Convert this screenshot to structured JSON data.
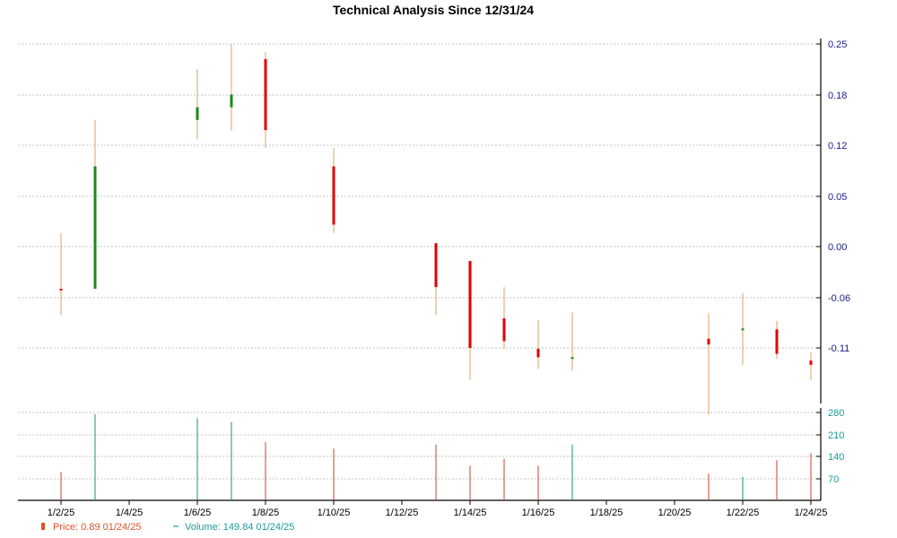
{
  "chart_data": {
    "type": "candlestick",
    "title": "Technical Analysis Since 12/31/24",
    "price_axis": {
      "ticks": [
        "0.25",
        "0.18",
        "0.12",
        "0.05",
        "0.00",
        "-0.06",
        "-0.11"
      ],
      "ylim": [
        -0.25,
        0.25
      ]
    },
    "volume_axis": {
      "ticks": [
        "280",
        "210",
        "140",
        "70"
      ],
      "ylim": [
        0,
        280
      ]
    },
    "x_ticks": [
      "1/2/25",
      "1/4/25",
      "1/6/25",
      "1/8/25",
      "1/10/25",
      "1/12/25",
      "1/14/25",
      "1/16/25",
      "1/18/25",
      "1/20/25",
      "1/22/25",
      "1/24/25"
    ],
    "candles": [
      {
        "date": "1/2/25",
        "open": -0.04,
        "high": 0.026,
        "low": -0.071,
        "close": -0.042,
        "volume": 90
      },
      {
        "date": "1/3/25",
        "open": -0.04,
        "high": 0.16,
        "low": -0.04,
        "close": 0.105,
        "volume": 275
      },
      {
        "date": "1/6/25",
        "open": 0.16,
        "high": 0.22,
        "low": 0.137,
        "close": 0.175,
        "volume": 262
      },
      {
        "date": "1/7/25",
        "open": 0.175,
        "high": 0.25,
        "low": 0.147,
        "close": 0.19,
        "volume": 250
      },
      {
        "date": "1/8/25",
        "open": 0.232,
        "high": 0.24,
        "low": 0.127,
        "close": 0.148,
        "volume": 185
      },
      {
        "date": "1/10/25",
        "open": 0.105,
        "high": 0.127,
        "low": 0.026,
        "close": 0.036,
        "volume": 165
      },
      {
        "date": "1/13/25",
        "open": 0.014,
        "high": 0.014,
        "low": -0.071,
        "close": -0.038,
        "volume": 178
      },
      {
        "date": "1/14/25",
        "open": -0.007,
        "high": -0.007,
        "low": -0.148,
        "close": -0.11,
        "volume": 110
      },
      {
        "date": "1/15/25",
        "open": -0.075,
        "high": -0.038,
        "low": -0.111,
        "close": -0.102,
        "volume": 132
      },
      {
        "date": "1/16/25",
        "open": -0.111,
        "high": -0.077,
        "low": -0.135,
        "close": -0.121,
        "volume": 110
      },
      {
        "date": "1/17/25",
        "open": -0.122,
        "high": -0.068,
        "low": -0.137,
        "close": -0.122,
        "volume": 178
      },
      {
        "date": "1/21/25",
        "open": -0.099,
        "high": -0.069,
        "low": -0.189,
        "close": -0.106,
        "volume": 85
      },
      {
        "date": "1/22/25",
        "open": -0.088,
        "high": -0.045,
        "low": -0.13,
        "close": -0.088,
        "volume": 75
      },
      {
        "date": "1/23/25",
        "open": -0.088,
        "high": -0.078,
        "low": -0.123,
        "close": -0.117,
        "volume": 128
      },
      {
        "date": "1/24/25",
        "open": -0.125,
        "high": -0.115,
        "low": -0.148,
        "close": -0.13,
        "volume": 149.84
      }
    ],
    "legend": {
      "price_label": "Price: 0.89  01/24/25",
      "volume_label": "Volume: 149.84  01/24/25"
    },
    "colors": {
      "up": "#1a8a1a",
      "down": "#e00000",
      "wick": "#e0a060",
      "vol_up": "#1a9a5a",
      "vol_down": "#c0442a",
      "grid": "#b0b0b0"
    }
  }
}
